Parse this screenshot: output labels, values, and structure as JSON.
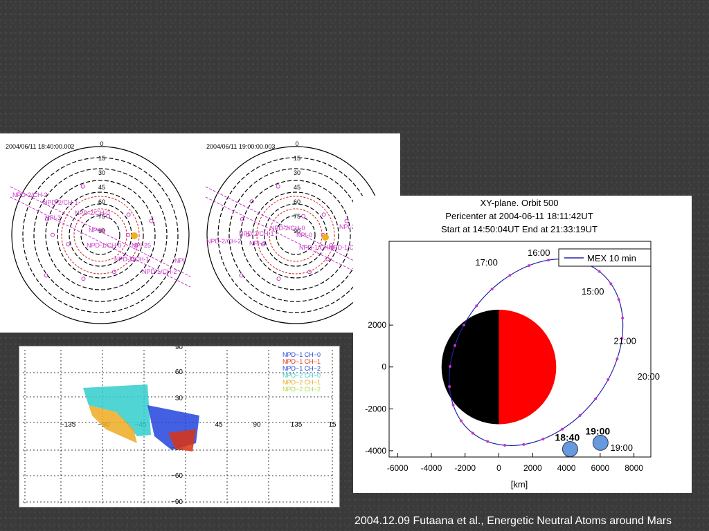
{
  "footer": "2004.12.09 Futaana et al., Energetic Neutral Atoms around Mars",
  "colors": {
    "label": "#cc33cc",
    "ring_red": "#cc2222",
    "dot": "#f0b020",
    "mars_day": "#ff0000",
    "mars_night": "#000000",
    "orbit": "#2222aa",
    "mex": "#6699dd"
  },
  "polar": {
    "left": {
      "timestamp": "2004/06/11 18:40:00.002",
      "ring_labels": [
        "0",
        "15",
        "30",
        "45",
        "60",
        "75",
        "90"
      ],
      "labels": [
        "NPD-2/CH-2",
        "NPD-2/CH-1",
        "NPD-2/CH-0",
        "NPI-3",
        "NPI-9",
        "NPD-1/CH-0",
        "NPI-25",
        "NPD-1/CH-1",
        "NPD-1/CH-2",
        "NPI"
      ]
    },
    "right": {
      "timestamp": "2004/06/11 19:00:00.003",
      "ring_labels": [
        "0",
        "15",
        "30",
        "45",
        "60",
        "75",
        "90"
      ],
      "labels": [
        "NPD-2/CH-1",
        "NPD-2/CH-0",
        "NPD-2/CH-2",
        "NPI-4",
        "NPI-0",
        "NPD-1/CH-0",
        "NPD-1/CH-1",
        "NPI-26"
      ]
    }
  },
  "map": {
    "x_ticks": [
      "−135",
      "−90",
      "−45",
      "45",
      "90",
      "135",
      "15"
    ],
    "y_ticks": [
      "90",
      "60",
      "30",
      "−30",
      "−60",
      "−90"
    ],
    "legend": [
      "NPD−1 CH−0",
      "NPD−1 CH−1",
      "NPD−1 CH−2",
      "NPD−2 CH−0",
      "NPD−2 CH−1",
      "NPD−2 CH−2"
    ]
  },
  "chart_data": {
    "type": "scatter",
    "title": "XY-plane.  Orbit 500",
    "subtitle1": "Pericenter at 2004-06-11 18:11:42UT",
    "subtitle2": "Start at 14:50:04UT End at 21:33:19UT",
    "xlabel": "[km]",
    "xlim": [
      -6500,
      9000
    ],
    "ylim": [
      -4300,
      6000
    ],
    "x_ticks": [
      -6000,
      -4000,
      -2000,
      0,
      2000,
      4000,
      6000,
      8000
    ],
    "y_ticks": [
      2000,
      0,
      -2000,
      -4000
    ],
    "legend": "MEX 10 min",
    "time_labels": [
      {
        "text": "16:00",
        "x": 1700,
        "y": 5300
      },
      {
        "text": "17:00",
        "x": -1400,
        "y": 4850
      },
      {
        "text": "15:00",
        "x": 4900,
        "y": 3450
      },
      {
        "text": "21:00",
        "x": 6800,
        "y": 1100
      },
      {
        "text": "20:00",
        "x": 8200,
        "y": -600
      },
      {
        "text": "19:00",
        "x": 6600,
        "y": -4000
      }
    ],
    "mex_labels": [
      {
        "text": "18:40",
        "x": 3400,
        "y": -4250
      },
      {
        "text": "19:00",
        "x": 5200,
        "y": -3950
      }
    ]
  }
}
